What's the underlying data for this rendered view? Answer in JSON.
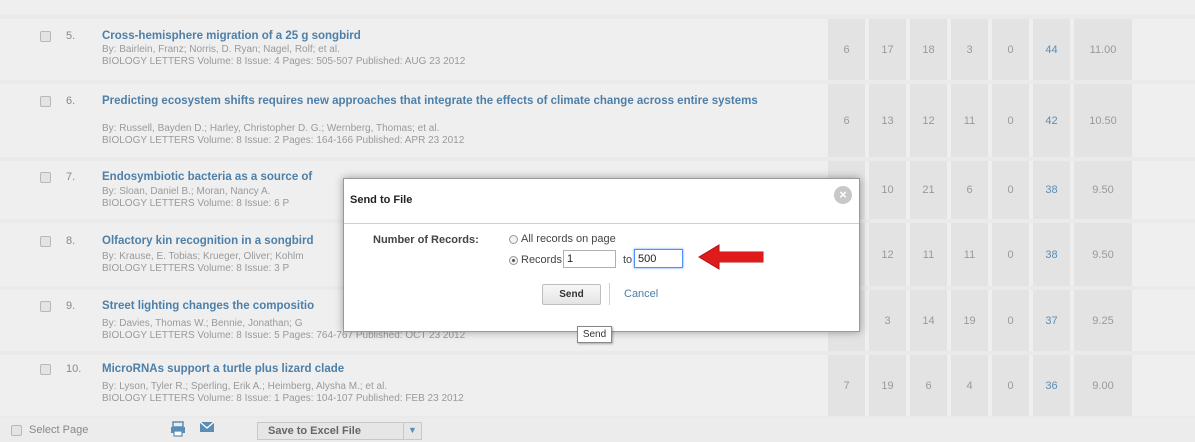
{
  "records": [
    {
      "num": "5.",
      "title": "Cross-hemisphere migration of a 25 g songbird",
      "authors": "By: Bairlein, Franz; Norris, D. Ryan; Nagel, Rolf; et al.",
      "source": "BIOLOGY LETTERS  Volume: 8   Issue: 4   Pages: 505-507   Published: AUG 23 2012",
      "c1": "6",
      "c2": "17",
      "c3": "18",
      "c4": "3",
      "c5": "0",
      "total": "44",
      "avg": "11.00"
    },
    {
      "num": "6.",
      "title": "Predicting ecosystem shifts requires new approaches that integrate the effects of climate change across entire systems",
      "authors": "By: Russell, Bayden D.; Harley, Christopher D. G.; Wernberg, Thomas; et al.",
      "source": "BIOLOGY LETTERS  Volume: 8   Issue: 2   Pages: 164-166   Published: APR 23 2012",
      "c1": "6",
      "c2": "13",
      "c3": "12",
      "c4": "11",
      "c5": "0",
      "total": "42",
      "avg": "10.50"
    },
    {
      "num": "7.",
      "title": "Endosymbiotic bacteria as a source of",
      "authors": "By: Sloan, Daniel B.; Moran, Nancy A.",
      "source": "BIOLOGY LETTERS  Volume: 8   Issue: 6   P",
      "c1": "",
      "c2": "10",
      "c3": "21",
      "c4": "6",
      "c5": "0",
      "total": "38",
      "avg": "9.50"
    },
    {
      "num": "8.",
      "title": "Olfactory kin recognition in a songbird",
      "authors": "By: Krause, E. Tobias; Krueger, Oliver; Kohlm",
      "source": "BIOLOGY LETTERS  Volume: 8   Issue: 3   P",
      "c1": "",
      "c2": "12",
      "c3": "11",
      "c4": "11",
      "c5": "0",
      "total": "38",
      "avg": "9.50"
    },
    {
      "num": "9.",
      "title": "Street lighting changes the compositio",
      "authors": "By: Davies, Thomas W.; Bennie, Jonathan; G",
      "source": "BIOLOGY LETTERS  Volume: 8   Issue: 5   Pages: 764-767   Published: OCT 23 2012",
      "c1": "",
      "c2": "3",
      "c3": "14",
      "c4": "19",
      "c5": "0",
      "total": "37",
      "avg": "9.25"
    },
    {
      "num": "10.",
      "title": "MicroRNAs support a turtle plus lizard clade",
      "authors": "By: Lyson, Tyler R.; Sperling, Erik A.; Heimberg, Alysha M.; et al.",
      "source": "BIOLOGY LETTERS  Volume: 8   Issue: 1   Pages: 104-107   Published: FEB 23 2012",
      "c1": "7",
      "c2": "19",
      "c3": "6",
      "c4": "4",
      "c5": "0",
      "total": "36",
      "avg": "9.00"
    }
  ],
  "bottom": {
    "select_page": "Select Page",
    "export_option": "Save to Excel File"
  },
  "dialog": {
    "title": "Send to File",
    "close_glyph": "×",
    "number_label": "Number of Records:",
    "option_all": "All records on page",
    "option_range": "Records",
    "range_from": "1",
    "range_to_label": "to",
    "range_to": "500",
    "send_label": "Send",
    "cancel_label": "Cancel",
    "tooltip": "Send"
  },
  "colors": {
    "link": "#4d7fa8",
    "arrow": "#e01b1b"
  }
}
